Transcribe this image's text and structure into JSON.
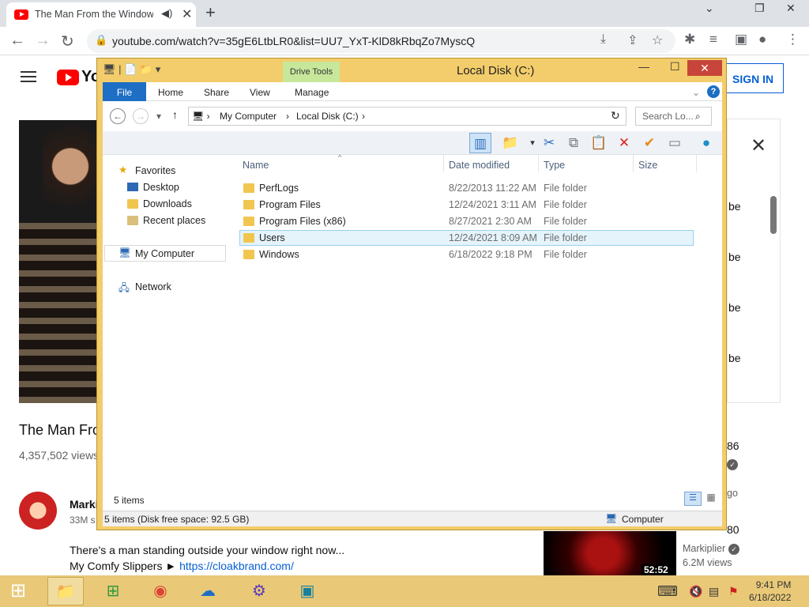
{
  "browser": {
    "tab_title": "The Man From the Window",
    "url": "youtube.com/watch?v=35gE6LtbLR0&list=UU7_YxT-KlD8kRbqZo7MyscQ",
    "new_tab": "+",
    "min": "⌄",
    "restore": "❐",
    "close": "✕"
  },
  "youtube": {
    "logo_text": "Yo",
    "sign_in": "SIGN IN",
    "video_title": "The Man Fro",
    "views": "4,357,502 views",
    "channel": "Marki",
    "subs": "33M s",
    "desc_line1": "There's a man standing outside your window right now...",
    "desc_line2": "My Comfy Slippers ► ",
    "desc_link": "https://cloakbrand.com/",
    "right_be": "be",
    "right_86": "86",
    "right_go": "go",
    "right_80": "80",
    "rec_duration": "52:52",
    "rec_channel": "Markiplier",
    "rec_views": "6.2M views"
  },
  "explorer": {
    "title": "Local Disk (C:)",
    "drive_tools": "Drive Tools",
    "tabs": {
      "file": "File",
      "home": "Home",
      "share": "Share",
      "view": "View",
      "manage": "Manage"
    },
    "breadcrumb": [
      "My Computer",
      "Local Disk (C:)"
    ],
    "search_placeholder": "Search Lo...",
    "nav": {
      "favorites": "Favorites",
      "desktop": "Desktop",
      "downloads": "Downloads",
      "recent": "Recent places",
      "computer": "My Computer",
      "network": "Network"
    },
    "columns": {
      "name": "Name",
      "date": "Date modified",
      "type": "Type",
      "size": "Size"
    },
    "files": [
      {
        "name": "PerfLogs",
        "date": "8/22/2013 11:22 AM",
        "type": "File folder"
      },
      {
        "name": "Program Files",
        "date": "12/24/2021 3:11 AM",
        "type": "File folder"
      },
      {
        "name": "Program Files (x86)",
        "date": "8/27/2021 2:30 AM",
        "type": "File folder"
      },
      {
        "name": "Users",
        "date": "12/24/2021 8:09 AM",
        "type": "File folder"
      },
      {
        "name": "Windows",
        "date": "6/18/2022 9:18 PM",
        "type": "File folder"
      }
    ],
    "item_count": "5 items",
    "status": "5 items (Disk free space: 92.5 GB)",
    "status_location": "Computer"
  },
  "taskbar": {
    "time": "9:41 PM",
    "date": "6/18/2022"
  }
}
